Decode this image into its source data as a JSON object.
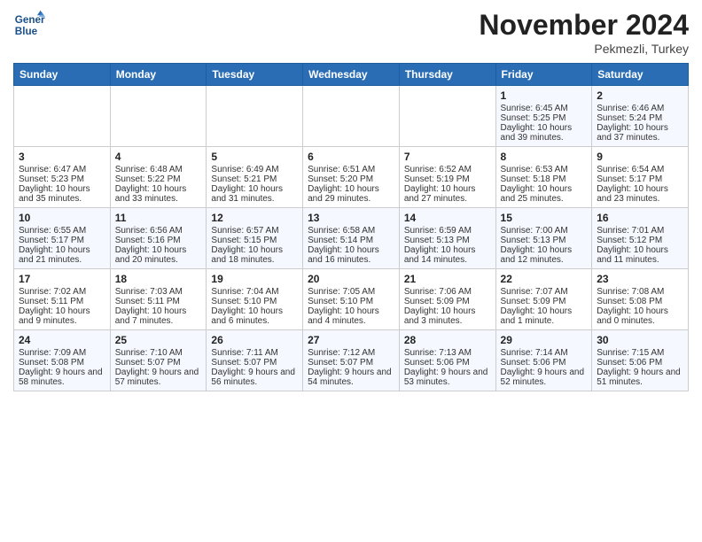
{
  "header": {
    "logo_line1": "General",
    "logo_line2": "Blue",
    "month": "November 2024",
    "location": "Pekmezli, Turkey"
  },
  "weekdays": [
    "Sunday",
    "Monday",
    "Tuesday",
    "Wednesday",
    "Thursday",
    "Friday",
    "Saturday"
  ],
  "weeks": [
    [
      {
        "day": "",
        "info": ""
      },
      {
        "day": "",
        "info": ""
      },
      {
        "day": "",
        "info": ""
      },
      {
        "day": "",
        "info": ""
      },
      {
        "day": "",
        "info": ""
      },
      {
        "day": "1",
        "info": "Sunrise: 6:45 AM\nSunset: 5:25 PM\nDaylight: 10 hours and 39 minutes."
      },
      {
        "day": "2",
        "info": "Sunrise: 6:46 AM\nSunset: 5:24 PM\nDaylight: 10 hours and 37 minutes."
      }
    ],
    [
      {
        "day": "3",
        "info": "Sunrise: 6:47 AM\nSunset: 5:23 PM\nDaylight: 10 hours and 35 minutes."
      },
      {
        "day": "4",
        "info": "Sunrise: 6:48 AM\nSunset: 5:22 PM\nDaylight: 10 hours and 33 minutes."
      },
      {
        "day": "5",
        "info": "Sunrise: 6:49 AM\nSunset: 5:21 PM\nDaylight: 10 hours and 31 minutes."
      },
      {
        "day": "6",
        "info": "Sunrise: 6:51 AM\nSunset: 5:20 PM\nDaylight: 10 hours and 29 minutes."
      },
      {
        "day": "7",
        "info": "Sunrise: 6:52 AM\nSunset: 5:19 PM\nDaylight: 10 hours and 27 minutes."
      },
      {
        "day": "8",
        "info": "Sunrise: 6:53 AM\nSunset: 5:18 PM\nDaylight: 10 hours and 25 minutes."
      },
      {
        "day": "9",
        "info": "Sunrise: 6:54 AM\nSunset: 5:17 PM\nDaylight: 10 hours and 23 minutes."
      }
    ],
    [
      {
        "day": "10",
        "info": "Sunrise: 6:55 AM\nSunset: 5:17 PM\nDaylight: 10 hours and 21 minutes."
      },
      {
        "day": "11",
        "info": "Sunrise: 6:56 AM\nSunset: 5:16 PM\nDaylight: 10 hours and 20 minutes."
      },
      {
        "day": "12",
        "info": "Sunrise: 6:57 AM\nSunset: 5:15 PM\nDaylight: 10 hours and 18 minutes."
      },
      {
        "day": "13",
        "info": "Sunrise: 6:58 AM\nSunset: 5:14 PM\nDaylight: 10 hours and 16 minutes."
      },
      {
        "day": "14",
        "info": "Sunrise: 6:59 AM\nSunset: 5:13 PM\nDaylight: 10 hours and 14 minutes."
      },
      {
        "day": "15",
        "info": "Sunrise: 7:00 AM\nSunset: 5:13 PM\nDaylight: 10 hours and 12 minutes."
      },
      {
        "day": "16",
        "info": "Sunrise: 7:01 AM\nSunset: 5:12 PM\nDaylight: 10 hours and 11 minutes."
      }
    ],
    [
      {
        "day": "17",
        "info": "Sunrise: 7:02 AM\nSunset: 5:11 PM\nDaylight: 10 hours and 9 minutes."
      },
      {
        "day": "18",
        "info": "Sunrise: 7:03 AM\nSunset: 5:11 PM\nDaylight: 10 hours and 7 minutes."
      },
      {
        "day": "19",
        "info": "Sunrise: 7:04 AM\nSunset: 5:10 PM\nDaylight: 10 hours and 6 minutes."
      },
      {
        "day": "20",
        "info": "Sunrise: 7:05 AM\nSunset: 5:10 PM\nDaylight: 10 hours and 4 minutes."
      },
      {
        "day": "21",
        "info": "Sunrise: 7:06 AM\nSunset: 5:09 PM\nDaylight: 10 hours and 3 minutes."
      },
      {
        "day": "22",
        "info": "Sunrise: 7:07 AM\nSunset: 5:09 PM\nDaylight: 10 hours and 1 minute."
      },
      {
        "day": "23",
        "info": "Sunrise: 7:08 AM\nSunset: 5:08 PM\nDaylight: 10 hours and 0 minutes."
      }
    ],
    [
      {
        "day": "24",
        "info": "Sunrise: 7:09 AM\nSunset: 5:08 PM\nDaylight: 9 hours and 58 minutes."
      },
      {
        "day": "25",
        "info": "Sunrise: 7:10 AM\nSunset: 5:07 PM\nDaylight: 9 hours and 57 minutes."
      },
      {
        "day": "26",
        "info": "Sunrise: 7:11 AM\nSunset: 5:07 PM\nDaylight: 9 hours and 56 minutes."
      },
      {
        "day": "27",
        "info": "Sunrise: 7:12 AM\nSunset: 5:07 PM\nDaylight: 9 hours and 54 minutes."
      },
      {
        "day": "28",
        "info": "Sunrise: 7:13 AM\nSunset: 5:06 PM\nDaylight: 9 hours and 53 minutes."
      },
      {
        "day": "29",
        "info": "Sunrise: 7:14 AM\nSunset: 5:06 PM\nDaylight: 9 hours and 52 minutes."
      },
      {
        "day": "30",
        "info": "Sunrise: 7:15 AM\nSunset: 5:06 PM\nDaylight: 9 hours and 51 minutes."
      }
    ]
  ]
}
